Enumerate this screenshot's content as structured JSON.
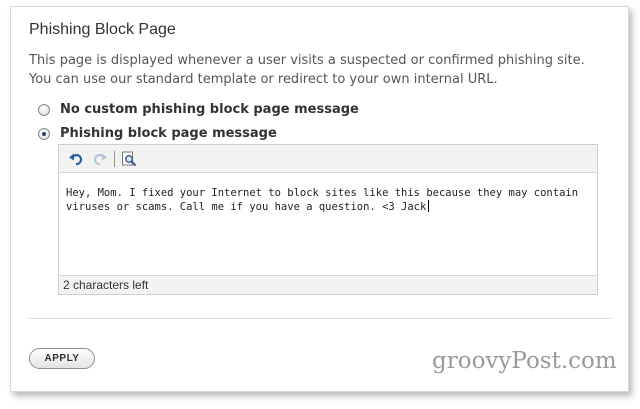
{
  "page": {
    "title": "Phishing Block Page",
    "description": "This page is displayed whenever a user visits a suspected or confirmed phishing site. You can use our standard template or redirect to your own internal URL."
  },
  "options": [
    {
      "label": "No custom phishing block page message",
      "checked": false
    },
    {
      "label": "Phishing block page message",
      "checked": true
    }
  ],
  "editor": {
    "toolbar": {
      "icons": [
        "undo-icon",
        "redo-icon",
        "preview-icon"
      ]
    },
    "content": "Hey, Mom. I fixed your Internet to block sites like this because they may contain viruses or scams. Call me if you have a question. <3 Jack",
    "status": "2 characters left"
  },
  "actions": {
    "apply_label": "APPLY"
  },
  "watermark": "groovyPost.com"
}
